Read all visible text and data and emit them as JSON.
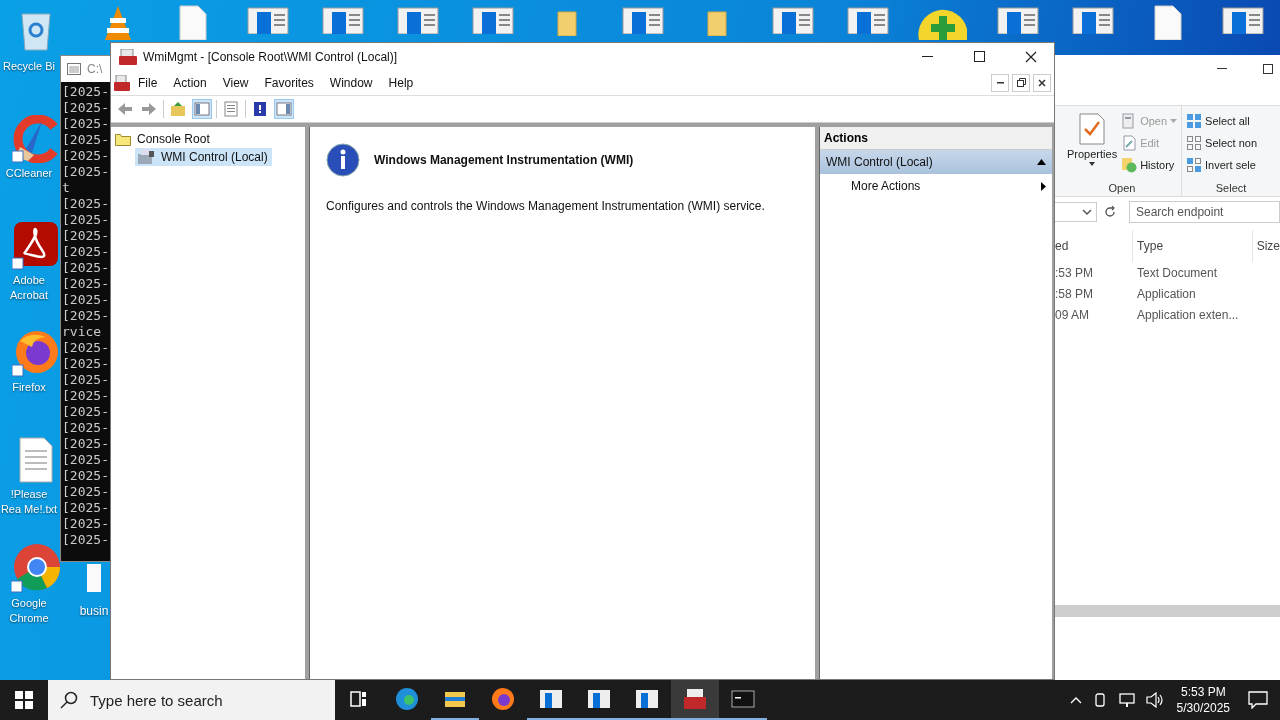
{
  "desktop": {
    "icons": [
      {
        "label": "Recycle Bi",
        "kind": "recycle",
        "shortcut": false
      },
      {
        "label": "CCleaner",
        "kind": "ccleaner",
        "shortcut": true
      },
      {
        "label": "Adobe Acrobat",
        "kind": "acrobat",
        "shortcut": true
      },
      {
        "label": "Firefox",
        "kind": "firefox",
        "shortcut": true
      },
      {
        "label": "!Please Rea Me!.txt",
        "kind": "text",
        "shortcut": false
      },
      {
        "label": "Google Chrome",
        "kind": "chrome",
        "shortcut": true
      }
    ],
    "second_column": [
      {
        "label": "busin",
        "kind": "file"
      }
    ],
    "top_icons": [
      {
        "kind": "vlc"
      },
      {
        "kind": "file"
      },
      {
        "kind": "doc"
      },
      {
        "kind": "doc"
      },
      {
        "kind": "doc"
      },
      {
        "kind": "doc"
      },
      {
        "kind": "folder"
      },
      {
        "kind": "doc"
      },
      {
        "kind": "folder"
      },
      {
        "kind": "doc"
      },
      {
        "kind": "doc"
      },
      {
        "kind": "plus"
      },
      {
        "kind": "doc"
      },
      {
        "kind": "doc"
      },
      {
        "kind": "file"
      },
      {
        "kind": "doc"
      }
    ]
  },
  "console": {
    "title": "C:\\",
    "lines": [
      "[2025-",
      "[2025-",
      "[2025-",
      "[2025-",
      "[2025-",
      "[2025-",
      "t",
      "[2025-",
      "[2025-",
      "[2025-",
      "[2025-",
      "[2025-",
      "[2025-",
      "[2025-",
      "[2025-",
      "rvice",
      "[2025-",
      "[2025-",
      "[2025-",
      "[2025-",
      "[2025-",
      "[2025-",
      "[2025-",
      "[2025-",
      "[2025-",
      "[2025-",
      "[2025-",
      "[2025-",
      "[2025-"
    ]
  },
  "mmc": {
    "title": "WmiMgmt - [Console Root\\WMI Control (Local)]",
    "menu": [
      "File",
      "Action",
      "View",
      "Favorites",
      "Window",
      "Help"
    ],
    "toolbar": [
      {
        "kind": "back",
        "selected": false
      },
      {
        "kind": "forward",
        "selected": false
      },
      {
        "kind": "up",
        "selected": false
      },
      {
        "kind": "tree",
        "selected": true
      },
      {
        "kind": "list",
        "selected": false
      },
      {
        "kind": "help",
        "selected": false
      },
      {
        "kind": "pane",
        "selected": true
      }
    ],
    "tree": [
      {
        "label": "Console Root",
        "expanded": true,
        "children": [
          {
            "label": "WMI Control (Local)",
            "selected": true
          }
        ]
      }
    ],
    "content": {
      "heading": "Windows Management Instrumentation (WMI)",
      "description": "Configures and controls the Windows Management Instrumentation (WMI) service."
    },
    "actions": {
      "title": "Actions",
      "sections": [
        {
          "label": "WMI Control (Local)",
          "expanded": true,
          "items": [
            "More Actions"
          ]
        }
      ]
    }
  },
  "explorer": {
    "ribbon": [
      {
        "label": "Open",
        "items": [
          {
            "label": "Properties",
            "kind": "large",
            "disabled": false
          },
          {
            "label": "Open",
            "kind": "dropdown",
            "disabled": true
          },
          {
            "label": "Edit",
            "kind": "small",
            "disabled": true
          },
          {
            "label": "History",
            "kind": "small",
            "disabled": false
          }
        ]
      },
      {
        "label": "Select",
        "items": [
          {
            "label": "Select all",
            "kind": "small",
            "disabled": false
          },
          {
            "label": "Select non",
            "kind": "small",
            "disabled": false
          },
          {
            "label": "Invert sele",
            "kind": "small",
            "disabled": false
          }
        ]
      }
    ],
    "search": {
      "placeholder": "Search endpoint"
    },
    "columns": [
      "ed",
      "Type",
      "Size"
    ],
    "rows": [
      [
        ":53 PM",
        "Text Document"
      ],
      [
        ":58 PM",
        "Application"
      ],
      [
        "09 AM",
        "Application exten..."
      ]
    ]
  },
  "taskbar": {
    "search": {
      "placeholder": "Type here to search"
    },
    "apps": [
      {
        "kind": "taskview",
        "running": false,
        "selected": false
      },
      {
        "kind": "edge",
        "running": false,
        "selected": false
      },
      {
        "kind": "explorer",
        "running": true,
        "selected": false
      },
      {
        "kind": "firefox",
        "running": false,
        "selected": false
      },
      {
        "kind": "doc",
        "running": true,
        "selected": false
      },
      {
        "kind": "doc",
        "running": true,
        "selected": false
      },
      {
        "kind": "doc",
        "running": true,
        "selected": false
      },
      {
        "kind": "toolbox",
        "running": true,
        "selected": true
      },
      {
        "kind": "cmd",
        "running": true,
        "selected": false
      }
    ],
    "time": "5:53 PM",
    "date": "5/30/2025"
  }
}
